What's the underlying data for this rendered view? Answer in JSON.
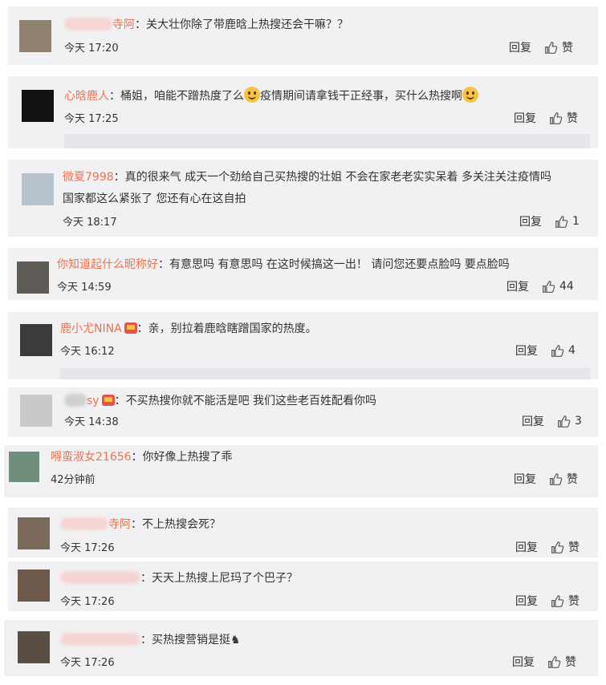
{
  "reply_label": "回复",
  "like_label": "赞",
  "comments": [
    {
      "name": "寺阿",
      "text": "：关大壮你除了带鹿晗上热搜还会干嘛？？",
      "time": "今天 17:20",
      "likes": "赞"
    },
    {
      "name": "心晗鹿人",
      "text_a": "：桶姐，咱能不蹭热度了么",
      "text_b": "疫情期间请拿钱干正经事，买什么热搜啊",
      "time": "今天 17:25",
      "likes": "赞"
    },
    {
      "name": "微夏7998",
      "text": "：真的很来气 成天一个劲给自己买热搜的壮姐 不会在家老老实实呆着 多关注关注疫情吗",
      "text2": "国家都这么紧张了 您还有心在这自拍",
      "time": "今天 18:17",
      "likes": "1"
    },
    {
      "name": "你知道起什么昵称好",
      "text": "：有意思吗 有意思吗 在这时候搞这一出！ 请问您还要点脸吗 要点脸吗",
      "time": "今天 14:59",
      "likes": "44"
    },
    {
      "name": "鹿小尤NINA",
      "text": "：亲，别拉着鹿晗瞎蹭国家的热度。",
      "time": "今天 16:12",
      "likes": "4"
    },
    {
      "name": "sy",
      "text": "：不买热搜你就不能活是吧  我们这些老百姓配看你吗",
      "time": "今天 14:38",
      "likes": "3"
    },
    {
      "name": "嘚蛮淑女21656",
      "text": "：你好像上热搜了乖",
      "time": "42分钟前",
      "likes": "赞"
    },
    {
      "name": "寺阿",
      "text": "：不上热搜会死？",
      "time": "今天 17:26",
      "likes": "赞"
    },
    {
      "name": "",
      "text": "：天天上热搜上尼玛了个巴子？",
      "time": "今天 17:26",
      "likes": "赞"
    },
    {
      "name": "",
      "text": "：买热搜营销是挺",
      "time": "今天 17:26",
      "likes": "赞"
    }
  ]
}
